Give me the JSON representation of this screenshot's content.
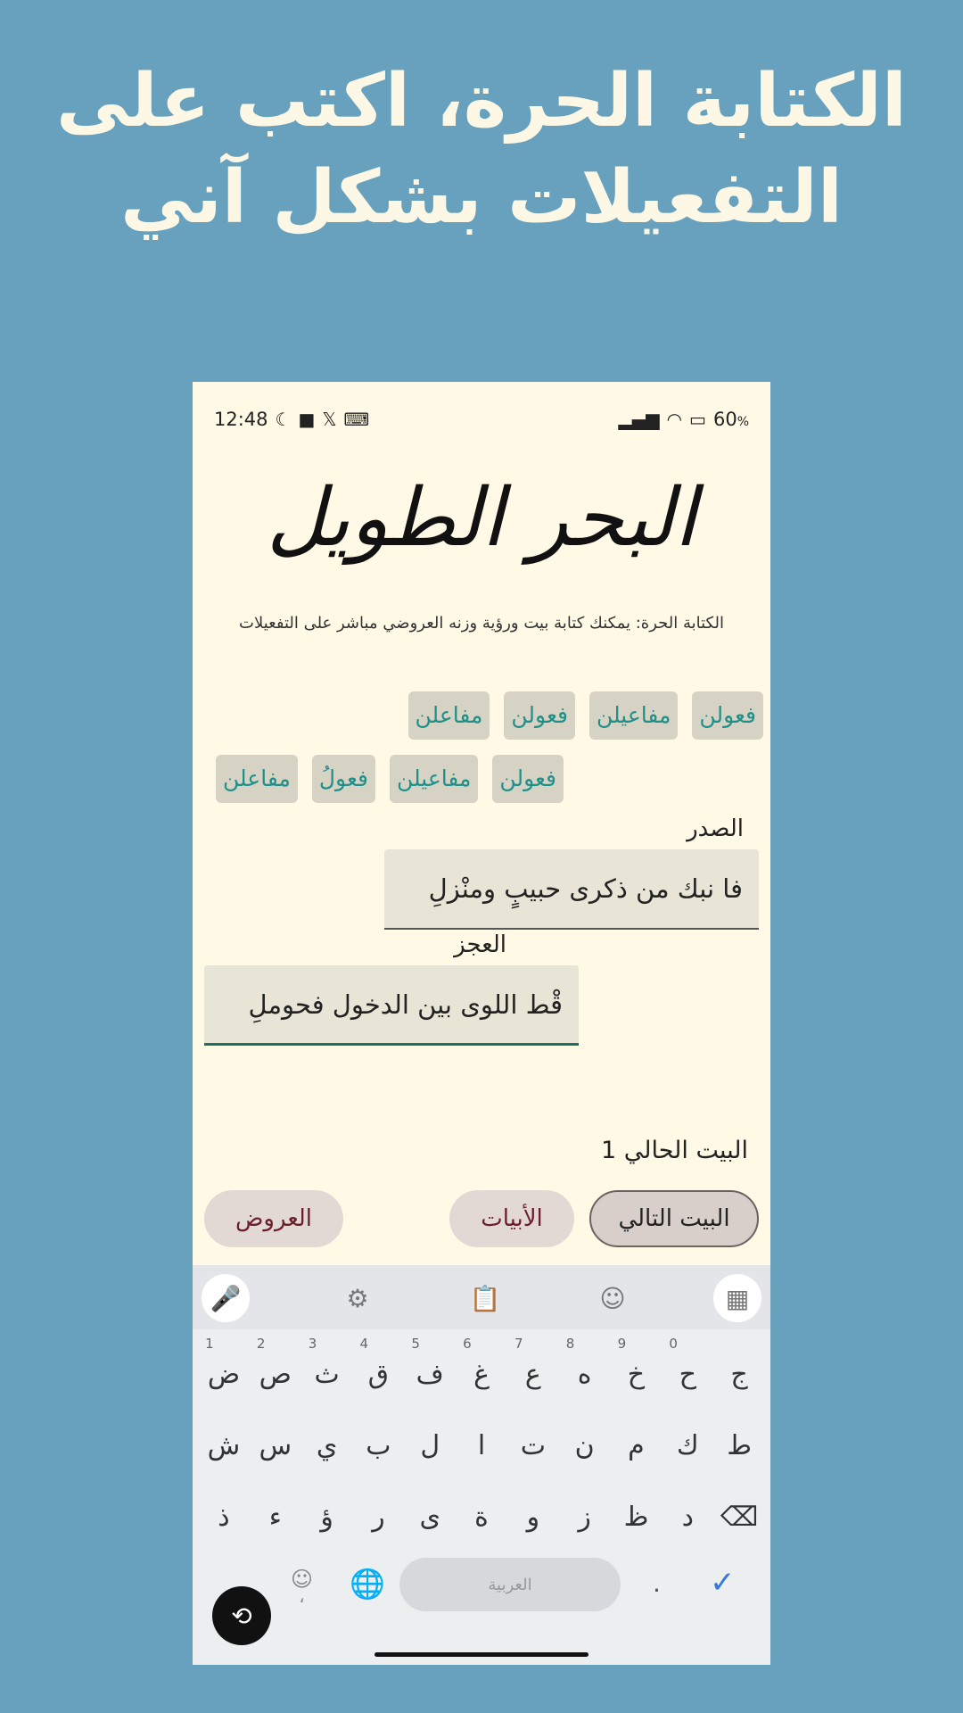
{
  "headline": {
    "line1": "الكتابة الحرة، اكتب على",
    "line2": "التفعيلات بشكل آني"
  },
  "status_bar": {
    "time": "12:48",
    "battery": "60",
    "battery_unit": "%",
    "icons_left": [
      "moon-icon",
      "video-icon",
      "x-icon",
      "keyboard-icon"
    ],
    "icons_right": [
      "signal-icon",
      "wifi-icon",
      "battery-icon"
    ]
  },
  "app": {
    "title": "البحر الطويل",
    "subtitle": "الكتابة الحرة: يمكنك كتابة بيت ورؤية وزنه العروضي مباشر على التفعيلات",
    "chips_row1": [
      "فعولن",
      "مفاعيلن",
      "فعولن",
      "مفاعلن"
    ],
    "chips_row2": [
      "فعولن",
      "مفاعيلن",
      "فعولُ",
      "مفاعلن"
    ],
    "sadr_label": "الصدر",
    "sadr_value": "فا نبك من ذكرى حبيبٍ ومنْزلِ",
    "ajz_label": "العجز",
    "ajz_value": "قْط اللوى بين الدخول فحوملِ",
    "current_verse": "البيت الحالي 1",
    "buttons": {
      "next": "البيت التالي",
      "verses": "الأبيات",
      "prosody": "العروض"
    }
  },
  "keyboard": {
    "row1": [
      "ج",
      "ح",
      "خ",
      "ه",
      "ع",
      "غ",
      "ف",
      "ق",
      "ث",
      "ص",
      "ض"
    ],
    "row1_hints": [
      "",
      "0",
      "9",
      "8",
      "7",
      "6",
      "5",
      "4",
      "3",
      "2",
      "1"
    ],
    "row2": [
      "ط",
      "ك",
      "م",
      "ن",
      "ت",
      "ا",
      "ل",
      "ب",
      "ي",
      "س",
      "ش"
    ],
    "row3": [
      "د",
      "ظ",
      "ز",
      "و",
      "ة",
      "ى",
      "ر",
      "ؤ",
      "ء",
      "ذ"
    ],
    "space_label": "العربية",
    "period": ".",
    "comma": "،",
    "check": "✓",
    "toolbar": [
      "grid-icon",
      "sticker-icon",
      "clipboard-icon",
      "gear-icon",
      "mic-icon"
    ]
  },
  "colors": {
    "background": "#67a1bd",
    "app_bg": "#fff9e6",
    "chip_text": "#1f8f8a",
    "button_text": "#6c1f2b"
  }
}
